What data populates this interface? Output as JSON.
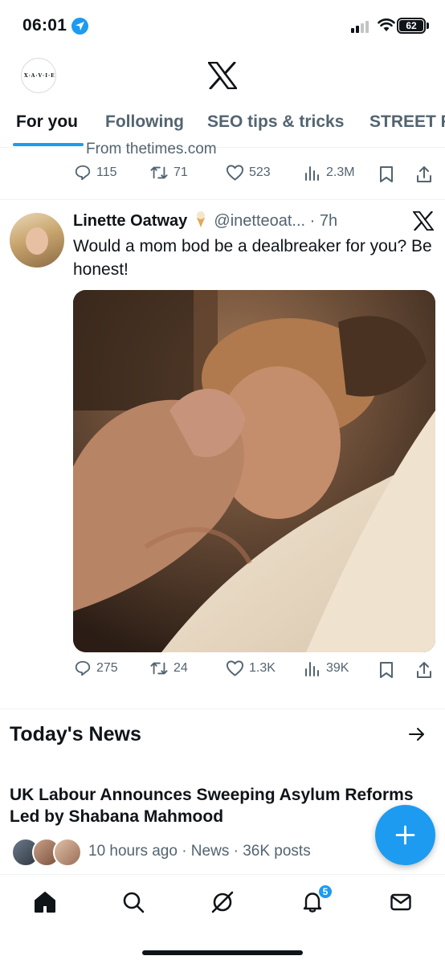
{
  "status_bar": {
    "time": "06:01",
    "battery": "62"
  },
  "header": {
    "account_logo_text": "X·A·V·I·E·R",
    "app_logo": "x-logo"
  },
  "tabs": [
    {
      "label": "For you",
      "active": true
    },
    {
      "label": "Following",
      "active": false
    },
    {
      "label": "SEO tips & tricks",
      "active": false
    },
    {
      "label": "STREET F",
      "active": false
    }
  ],
  "previous_tweet": {
    "source": "From thetimes.com",
    "replies": "115",
    "reposts": "71",
    "likes": "523",
    "views": "2.3M"
  },
  "tweet": {
    "name": "Linette Oatway",
    "emoji": "🍦",
    "handle": "@inetteoat...",
    "time": "· 7h",
    "text": "Would a mom bod be a dealbreaker for you? Be honest!",
    "replies": "275",
    "reposts": "24",
    "likes": "1.3K",
    "views": "39K"
  },
  "news": {
    "section_title": "Today's News",
    "headline": "UK Labour Announces Sweeping Asylum Reforms Led by Shabana Mahmood",
    "meta": "10 hours ago · News · 36K posts"
  },
  "bottom_nav": {
    "items": [
      "home-icon",
      "search-icon",
      "grok-icon",
      "notifications-icon",
      "messages-icon"
    ],
    "notification_count": "5"
  },
  "colors": {
    "accent": "#1d9bf0",
    "text": "#0f1419",
    "secondary_text": "#536471"
  }
}
